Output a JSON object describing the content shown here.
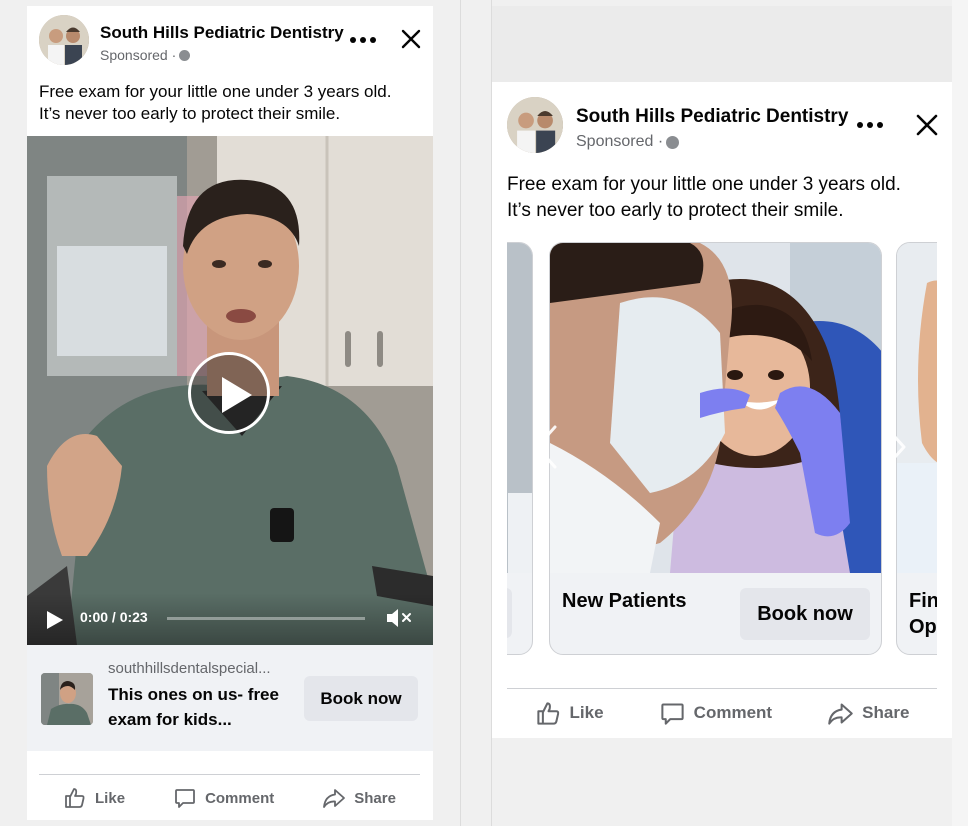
{
  "ad": {
    "page_name": "South Hills Pediatric Dentistry",
    "sponsored": "Sponsored ·",
    "caption_line1": "Free exam for your little one under 3 years old.",
    "caption_line2": "It’s never too early to protect their smile."
  },
  "video_ad": {
    "time": "0:00 / 0:23",
    "progress": 0.0,
    "link_domain": "southhillsdentalspecial...",
    "link_title": "This ones on us- free exam for kids...",
    "cta": "Book now"
  },
  "carousel_ad": {
    "cards": [
      {
        "title": "",
        "cta": ""
      },
      {
        "title": "New Patients",
        "cta": "Book now"
      },
      {
        "title": "Fin\nOpt",
        "cta": ""
      }
    ]
  },
  "actions": {
    "like": "Like",
    "comment": "Comment",
    "share": "Share"
  },
  "icons": [
    "more-options-icon",
    "close-icon",
    "globe-icon",
    "play-icon",
    "mute-icon",
    "like-icon",
    "comment-icon",
    "share-icon",
    "chevron-left-icon",
    "chevron-right-icon"
  ],
  "colors": {
    "secondary_text": "#65676b",
    "button_bg": "#e4e6eb",
    "card_bg": "#f0f2f5"
  }
}
